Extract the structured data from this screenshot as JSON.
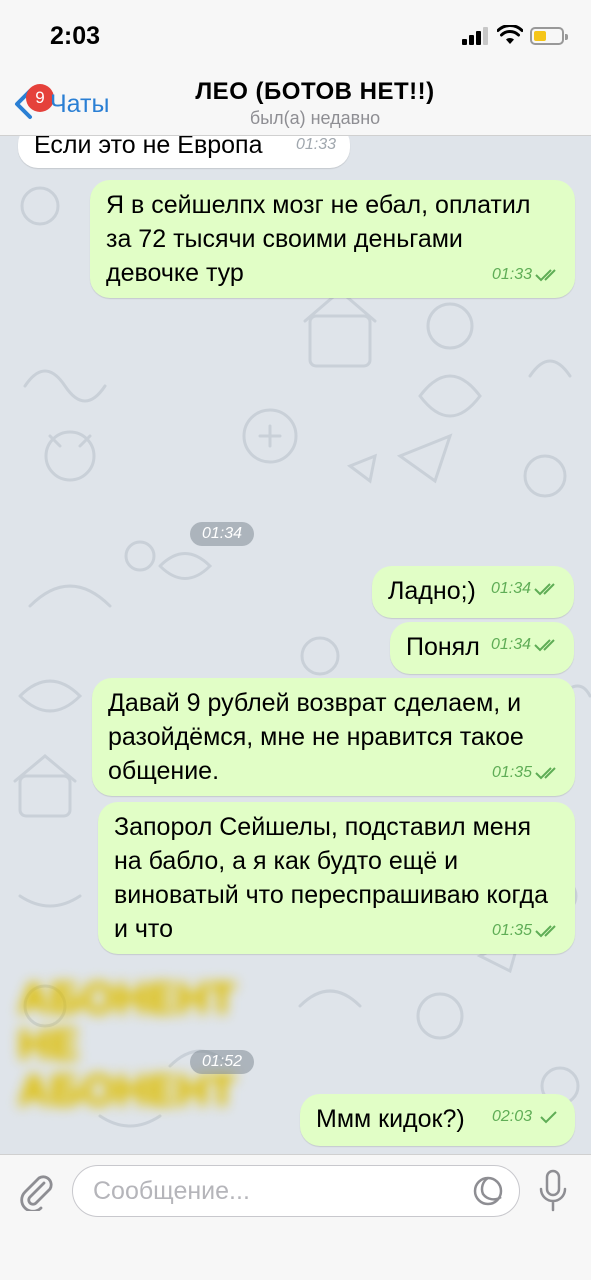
{
  "status_bar": {
    "time": "2:03"
  },
  "header": {
    "back_label": "Чаты",
    "unread_badge": "9",
    "title": "ЛЕО (БОТОВ НЕТ!!)",
    "subtitle": "был(а) недавно"
  },
  "messages": [
    {
      "direction": "in",
      "text": "Если это не Европа",
      "time": "01:33"
    },
    {
      "direction": "out",
      "text": "Я в сейшелпх мозг не ебал, оплатил за 72 тысячи своими деньгами девочке тур",
      "time": "01:33"
    },
    {
      "direction": "system",
      "text": "01:34"
    },
    {
      "direction": "out",
      "text": "Ладно;)",
      "time": "01:34"
    },
    {
      "direction": "out",
      "text": "Понял",
      "time": "01:34"
    },
    {
      "direction": "out",
      "text": "Давай 9 рублей возврат сделаем, и разойдёмся, мне не нравится такое общение.",
      "time": "01:35"
    },
    {
      "direction": "out",
      "text": "Запорол Сейшелы, подставил меня на бабло, а я как будто ещё и виноватый что переспрашиваю когда и что",
      "time": "01:35"
    },
    {
      "direction": "system",
      "text": "01:52",
      "media_text": [
        "АБОНЕНТ",
        "НЕ АБОНЕНТ"
      ]
    },
    {
      "direction": "out",
      "text": "Ммм кидок?)",
      "time": "02:03"
    }
  ],
  "input": {
    "placeholder": "Сообщение..."
  },
  "colors": {
    "outgoing_bubble": "#e1fec6",
    "incoming_bubble": "#ffffff",
    "accent": "#2a7fd4",
    "read_check": "#5fad56",
    "badge": "#e5413b",
    "chat_background": "#dfe4ea"
  },
  "icons": [
    "back-chevron-icon",
    "signal-icon",
    "wifi-icon",
    "battery-icon",
    "double-check-icon",
    "attach-icon",
    "sticker-icon",
    "microphone-icon"
  ]
}
